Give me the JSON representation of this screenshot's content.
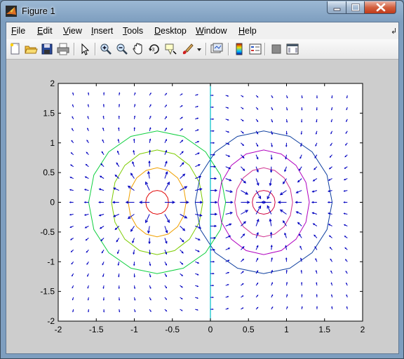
{
  "window": {
    "title": "Figure 1"
  },
  "menu": [
    {
      "label": "File",
      "name": "menu-file"
    },
    {
      "label": "Edit",
      "name": "menu-edit"
    },
    {
      "label": "View",
      "name": "menu-view"
    },
    {
      "label": "Insert",
      "name": "menu-insert"
    },
    {
      "label": "Tools",
      "name": "menu-tools"
    },
    {
      "label": "Desktop",
      "name": "menu-desktop"
    },
    {
      "label": "Window",
      "name": "menu-window"
    },
    {
      "label": "Help",
      "name": "menu-help"
    }
  ],
  "toolbar": [
    {
      "icon": "new-figure-icon"
    },
    {
      "icon": "open-file-icon"
    },
    {
      "icon": "save-figure-icon"
    },
    {
      "icon": "print-figure-icon"
    },
    {
      "icon": "edit-plot-icon"
    },
    {
      "icon": "zoom-in-icon"
    },
    {
      "icon": "zoom-out-icon"
    },
    {
      "icon": "pan-icon"
    },
    {
      "icon": "rotate-3d-icon"
    },
    {
      "icon": "data-cursor-icon"
    },
    {
      "icon": "brush-icon"
    },
    {
      "icon": "brush-dropdown-icon"
    },
    {
      "icon": "link-plot-icon"
    },
    {
      "icon": "insert-colorbar-icon"
    },
    {
      "icon": "insert-legend-icon"
    },
    {
      "icon": "hide-plot-tools-icon"
    },
    {
      "icon": "show-plot-tools-icon"
    }
  ],
  "chart_data": {
    "type": "contour+quiver",
    "title": "",
    "xlabel": "",
    "ylabel": "",
    "xlim": [
      -2,
      2
    ],
    "ylim": [
      -2,
      2
    ],
    "xticks": [
      "-2",
      "-1.5",
      "-1",
      "-0.5",
      "0",
      "0.5",
      "1",
      "1.5",
      "2"
    ],
    "yticks": [
      "2",
      "1.5",
      "1",
      "0.5",
      "0",
      "-0.5",
      "-1",
      "-1.5",
      "-2"
    ],
    "grid": false,
    "charges": [
      {
        "x": -0.7,
        "y": 0,
        "sign": 1
      },
      {
        "x": 0.7,
        "y": 0,
        "sign": -1
      }
    ],
    "contours": [
      {
        "center_x": -0.7,
        "rx": 0.15,
        "ry": 0.2,
        "color": "#e00000"
      },
      {
        "center_x": -0.7,
        "rx": 0.38,
        "ry": 0.58,
        "color": "#f0a000"
      },
      {
        "center_x": -0.7,
        "rx": 0.6,
        "ry": 0.88,
        "color": "#7ccc00"
      },
      {
        "center_x": -0.7,
        "rx": 0.9,
        "ry": 1.2,
        "color": "#10d040"
      },
      {
        "center_x": 0.7,
        "rx": 0.15,
        "ry": 0.2,
        "color": "#d00040"
      },
      {
        "center_x": 0.7,
        "rx": 0.38,
        "ry": 0.58,
        "color": "#d03090"
      },
      {
        "center_x": 0.7,
        "rx": 0.6,
        "ry": 0.88,
        "color": "#b000c0"
      },
      {
        "center_x": 0.7,
        "rx": 0.9,
        "ry": 1.2,
        "color": "#1040a0"
      }
    ],
    "zero_line": {
      "x": 0,
      "color": "#00c0c8"
    },
    "quiver": {
      "color": "#0000c0",
      "x_start": -1.8,
      "x_end": 1.8,
      "y_start": -1.8,
      "y_end": 1.8,
      "step": 0.2
    }
  }
}
